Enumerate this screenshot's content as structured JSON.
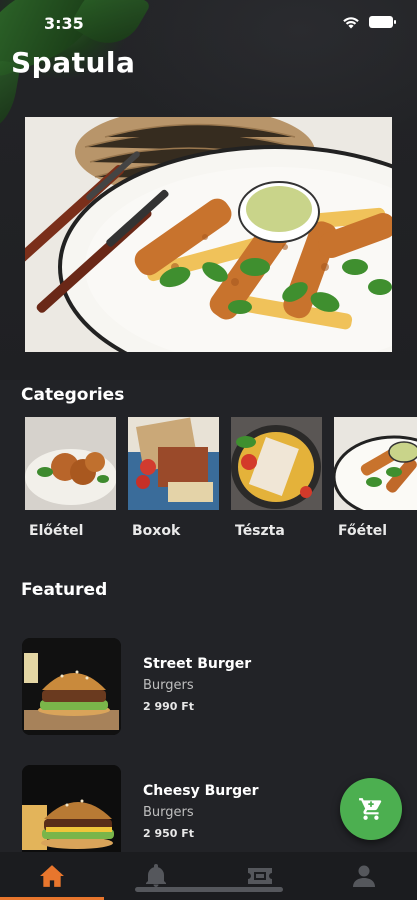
{
  "status_bar": {
    "time": "3:35"
  },
  "header": {
    "title": "Spatula"
  },
  "categories_section": {
    "title": "Categories",
    "items": [
      {
        "label": "Előétel"
      },
      {
        "label": "Boxok"
      },
      {
        "label": "Tészta"
      },
      {
        "label": "Főétel"
      }
    ]
  },
  "featured_section": {
    "title": "Featured",
    "items": [
      {
        "name": "Street Burger",
        "category": "Burgers",
        "price": "2 990 Ft"
      },
      {
        "name": "Cheesy Burger",
        "category": "Burgers",
        "price": "2 950 Ft"
      }
    ]
  },
  "bottom_nav": {
    "items": [
      {
        "icon": "home-icon",
        "active": true
      },
      {
        "icon": "bell-icon",
        "active": false
      },
      {
        "icon": "ticket-icon",
        "active": false
      },
      {
        "icon": "person-icon",
        "active": false
      }
    ]
  },
  "colors": {
    "background": "#222327",
    "accent": "#e8762d",
    "fab": "#4caf50",
    "nav_inactive": "#55575c"
  },
  "icons": {
    "fab": "cart-icon",
    "wifi": "wifi-icon",
    "battery": "battery-icon"
  }
}
